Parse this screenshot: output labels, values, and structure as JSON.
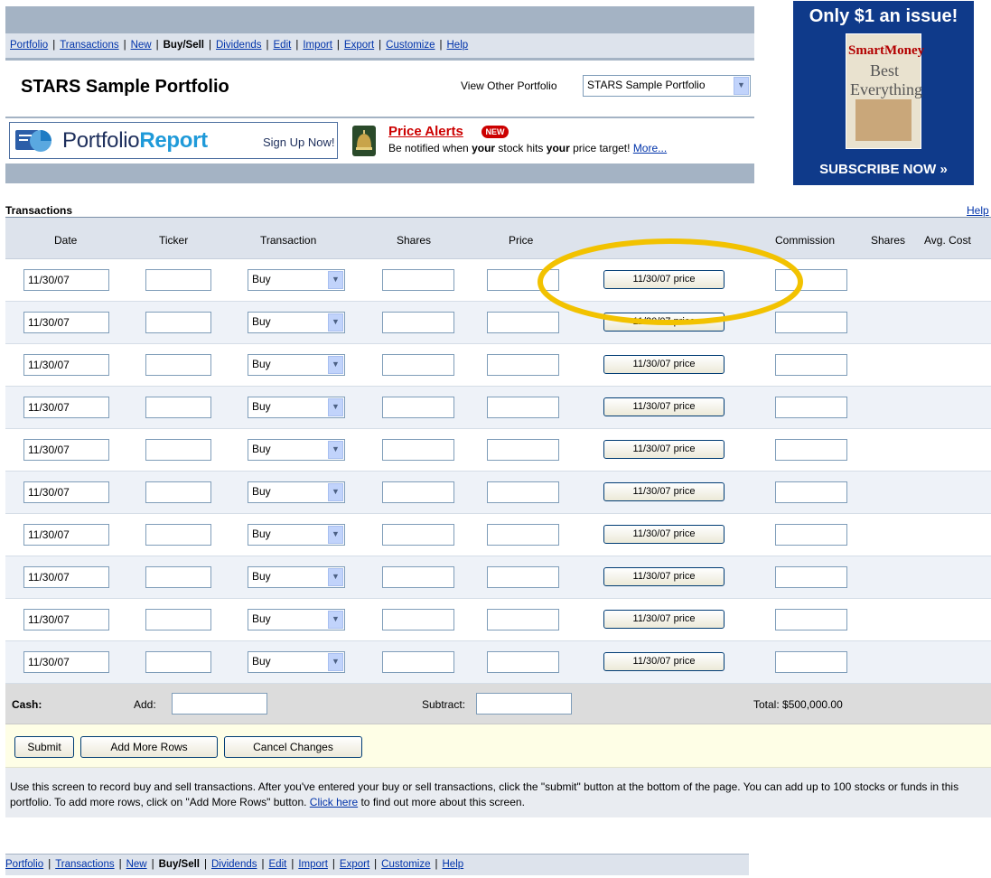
{
  "nav": {
    "items": [
      "Portfolio",
      "Transactions",
      "New",
      "Buy/Sell",
      "Dividends",
      "Edit",
      "Import",
      "Export",
      "Customize",
      "Help"
    ],
    "current": "Buy/Sell"
  },
  "header": {
    "portfolio_title": "STARS Sample Portfolio",
    "view_other_label": "View Other Portfolio",
    "view_other_selected": "STARS Sample Portfolio"
  },
  "promo": {
    "report_name_a": "Portfolio",
    "report_name_b": "Report",
    "report_signup": "Sign Up Now!",
    "alerts_title": "Price Alerts",
    "alerts_badge": "NEW",
    "alerts_desc_1": "Be notified when ",
    "alerts_desc_your1": "your",
    "alerts_desc_2": " stock hits ",
    "alerts_desc_your2": "your",
    "alerts_desc_3": " price target! ",
    "alerts_more": "More..."
  },
  "ad": {
    "top_text": "Only $1 an issue!",
    "cover_brand": "SmartMoney",
    "cover_headline": "Best Everything",
    "bottom_text": "SUBSCRIBE NOW »"
  },
  "transactions": {
    "title": "Transactions",
    "help": "Help",
    "headers": {
      "date": "Date",
      "ticker": "Ticker",
      "transaction": "Transaction",
      "shares": "Shares",
      "price": "Price",
      "commission": "Commission",
      "shares_owned": "Shares",
      "avg_cost": "Avg. Cost"
    },
    "rows": [
      {
        "date": "11/30/07",
        "type": "Buy",
        "price_button": "11/30/07 price"
      },
      {
        "date": "11/30/07",
        "type": "Buy",
        "price_button": "11/30/07 price"
      },
      {
        "date": "11/30/07",
        "type": "Buy",
        "price_button": "11/30/07 price"
      },
      {
        "date": "11/30/07",
        "type": "Buy",
        "price_button": "11/30/07 price"
      },
      {
        "date": "11/30/07",
        "type": "Buy",
        "price_button": "11/30/07 price"
      },
      {
        "date": "11/30/07",
        "type": "Buy",
        "price_button": "11/30/07 price"
      },
      {
        "date": "11/30/07",
        "type": "Buy",
        "price_button": "11/30/07 price"
      },
      {
        "date": "11/30/07",
        "type": "Buy",
        "price_button": "11/30/07 price"
      },
      {
        "date": "11/30/07",
        "type": "Buy",
        "price_button": "11/30/07 price"
      },
      {
        "date": "11/30/07",
        "type": "Buy",
        "price_button": "11/30/07 price"
      }
    ],
    "cash_label": "Cash:",
    "add_label": "Add:",
    "subtract_label": "Subtract:",
    "total": "Total: $500,000.00",
    "buttons": {
      "submit": "Submit",
      "add_rows": "Add More Rows",
      "cancel": "Cancel Changes"
    },
    "help_text_1": "Use this screen to record buy and sell transactions. After you've entered your buy or sell transactions, click the \"submit\" button at the bottom of the page. You can add up to 100 stocks or funds in this portfolio. To add more rows, click on \"Add More Rows\" button. ",
    "help_link": "Click here",
    "help_text_2": " to find out more about this screen."
  },
  "colors": {
    "nav_bg": "#dde3ec",
    "header_bg": "#a4b3c4",
    "link": "#0033aa",
    "alert_red": "#cc0000",
    "highlight_ellipse": "#f2c200",
    "ad_bg": "#0f3a8a"
  },
  "icons": {
    "select_arrow": "chevron-down-icon",
    "report_logo": "pie-chart-icon",
    "alerts_icon": "bell-icon"
  }
}
